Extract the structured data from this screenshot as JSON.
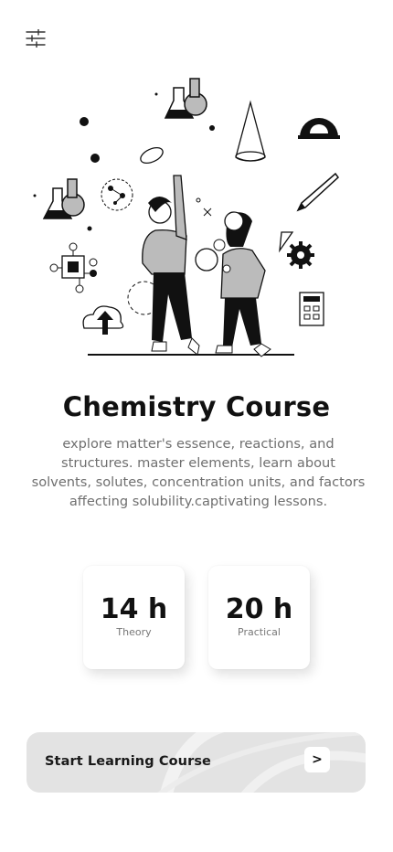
{
  "header": {
    "filter_icon": "sliders-icon"
  },
  "hero": {
    "illustration": "chemistry-students-illustration"
  },
  "course": {
    "title": "Chemistry Course",
    "description": "explore matter's essence, reactions, and structures. master elements, learn about solvents, solutes, concentration units, and factors affecting solubility.captivating lessons."
  },
  "stats": [
    {
      "value": "14 h",
      "label": "Theory"
    },
    {
      "value": "20 h",
      "label": "Practical"
    }
  ],
  "cta": {
    "label": "Start Learning Course",
    "arrow": ">"
  }
}
